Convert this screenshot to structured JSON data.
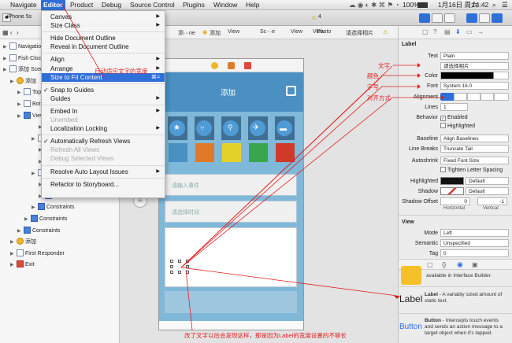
{
  "menubar": {
    "items": [
      "Navigate",
      "Editor",
      "Product",
      "Debug",
      "Source Control",
      "Plugins",
      "Window",
      "Help"
    ],
    "status_battery": "100%",
    "status_date": "1月16日 周六",
    "status_time": "14:42"
  },
  "toolbar": {
    "scheme_label": "iPhone 5s",
    "warning_count": "4"
  },
  "breadcrumb": {
    "items": [
      "添···ne",
      "添加",
      "View",
      "Sc···e",
      "View",
      "View",
      "Photo",
      "请选择相片"
    ]
  },
  "navigator": {
    "rows": [
      {
        "label": "Navigation",
        "indent": 0
      },
      {
        "label": "Fish Clock",
        "indent": 0
      },
      {
        "label": "添加 Scene",
        "indent": 0
      },
      {
        "label": "添加",
        "indent": 1
      },
      {
        "label": "Top",
        "indent": 2
      },
      {
        "label": "Bott",
        "indent": 2
      },
      {
        "label": "View",
        "indent": 2
      },
      {
        "label": "Constraints",
        "indent": 5
      },
      {
        "label": "Date",
        "indent": 4
      },
      {
        "label": "请选择时间",
        "indent": 5
      },
      {
        "label": "Constraints",
        "indent": 5
      },
      {
        "label": "Photo",
        "indent": 4
      },
      {
        "label": "请选择相片",
        "indent": 5
      },
      {
        "label": "Constraints",
        "indent": 5
      },
      {
        "label": "Constraints",
        "indent": 4
      },
      {
        "label": "Constraints",
        "indent": 3
      },
      {
        "label": "Constraints",
        "indent": 2
      },
      {
        "label": "添加",
        "indent": 1
      },
      {
        "label": "First Responder",
        "indent": 1
      },
      {
        "label": "Exit",
        "indent": 1
      }
    ]
  },
  "editor_menu": {
    "items": [
      {
        "label": "Canvas",
        "arrow": true
      },
      {
        "label": "Size Class",
        "arrow": true
      },
      {
        "sep": true
      },
      {
        "label": "Hide Document Outline"
      },
      {
        "label": "Reveal in Document Outline"
      },
      {
        "sep": true
      },
      {
        "label": "Align",
        "arrow": true
      },
      {
        "label": "Arrange",
        "arrow": true
      },
      {
        "label": "Size to Fit Content",
        "shortcut": "⌘=",
        "highlighted": true
      },
      {
        "sep": true
      },
      {
        "label": "Snap to Guides",
        "checked": true
      },
      {
        "label": "Guides",
        "arrow": true
      },
      {
        "sep": true
      },
      {
        "label": "Embed In",
        "arrow": true
      },
      {
        "label": "Unembed",
        "disabled": true
      },
      {
        "label": "Localization Locking",
        "arrow": true
      },
      {
        "sep": true
      },
      {
        "label": "Automatically Refresh Views",
        "checked": true
      },
      {
        "label": "Refresh All Views",
        "disabled": true
      },
      {
        "label": "Debug Selected Views",
        "disabled": true
      },
      {
        "sep": true
      },
      {
        "label": "Resolve Auto Layout Issues",
        "arrow": true
      },
      {
        "sep": true
      },
      {
        "label": "Refactor to Storyboard..."
      }
    ]
  },
  "phone": {
    "nav_title": "添加",
    "field_event_placeholder": "请输入事件",
    "field_time_placeholder": "请选择时间",
    "swatch_colors": [
      "#4a90c2",
      "#e07a2a",
      "#e6d12a",
      "#3aa54a",
      "#cf3a2a"
    ]
  },
  "inspector": {
    "section_label": "Label",
    "text_type": "Plain",
    "text_value": "请选择相片",
    "color_label": "Color",
    "font_value": "System 16.0",
    "lines_value": "1",
    "behavior_enabled": "Enabled",
    "behavior_highlighted": "Highlighted",
    "baseline_value": "Align Baselines",
    "line_breaks_value": "Truncate Tail",
    "autoshrink_value": "Fixed Font Size",
    "tighten_label": "Tighten Letter Spacing",
    "highlighted_value": "Default",
    "shadow_value": "Default",
    "shadow_offset_h": "0",
    "shadow_offset_v": "-1",
    "shadow_horizontal": "Horizontal",
    "shadow_vertical": "Vertical",
    "view_section": "View",
    "mode_value": "Left",
    "semantic_value": "Unspecified",
    "tag_value": "0",
    "labels": {
      "text": "Text",
      "font": "Font",
      "alignment": "Alignment",
      "lines": "Lines",
      "behavior": "Behavior",
      "baseline": "Baseline",
      "line_breaks": "Line Breaks",
      "autoshrink": "Autoshrink",
      "highlighted": "Highlighted",
      "shadow": "Shadow",
      "shadow_offset": "Shadow Offset",
      "mode": "Mode",
      "semantic": "Semantic",
      "tag": "Tag"
    }
  },
  "library": {
    "first_desc": "available in Interface Builder.",
    "label_title": "Label",
    "label_desc": " - A variably sized amount of static text.",
    "button_title": "Button",
    "button_desc": " - Intercepts touch events and sends an action message to a target object when it's tapped."
  },
  "annotations": {
    "menu_note": "自动适应文字的宽度",
    "text": "文字",
    "color": "颜色",
    "font": "字号",
    "align": "对齐方式",
    "bottom_note": "改了文字以后会发现这样，那是因为Label的宽度设置的不够长"
  }
}
